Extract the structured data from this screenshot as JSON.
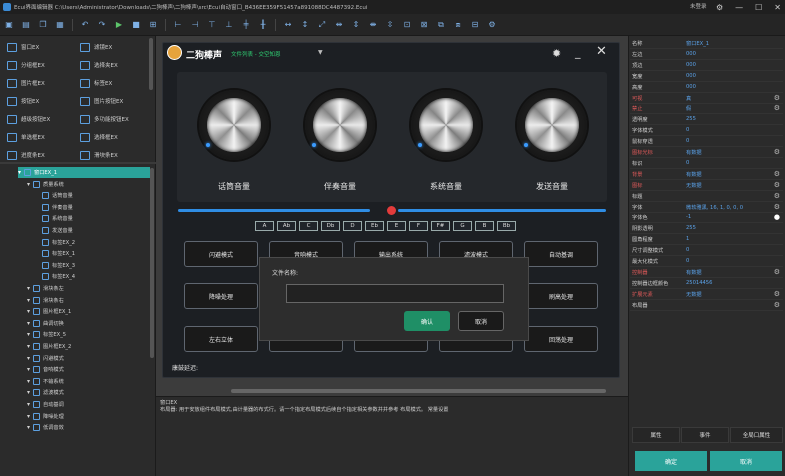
{
  "titlebar": {
    "title": "Ecui界面编辑器  C:\\Users\\Administrator\\Downloads\\二狗棒声\\二狗棒声\\src\\Ecui自动窗口_B436EE359F51457a891088DC4487392.Ecui",
    "login": "未登录"
  },
  "toolbox": {
    "items": [
      {
        "label": "窗口EX",
        "icon": "window-icon"
      },
      {
        "label": "滤镜EX",
        "icon": "filter-icon"
      },
      {
        "label": "分组框EX",
        "icon": "groupbox-icon"
      },
      {
        "label": "选择夹EX",
        "icon": "tab-icon"
      },
      {
        "label": "图片框EX",
        "icon": "picture-icon"
      },
      {
        "label": "标签EX",
        "icon": "tag-icon"
      },
      {
        "label": "按钮EX",
        "icon": "button-icon"
      },
      {
        "label": "图片按钮EX",
        "icon": "image-button-icon"
      },
      {
        "label": "超级按钮EX",
        "icon": "super-button-icon"
      },
      {
        "label": "多功能按钮EX",
        "icon": "multi-button-icon"
      },
      {
        "label": "单选框EX",
        "icon": "radio-icon"
      },
      {
        "label": "选择框EX",
        "icon": "checkbox-icon"
      },
      {
        "label": "进度条EX",
        "icon": "progress-icon"
      },
      {
        "label": "滑块条EX",
        "icon": "slider-icon"
      }
    ]
  },
  "tree": {
    "items": [
      {
        "label": "窗口EX_1",
        "indent": 0,
        "selected": true
      },
      {
        "label": "质量系统",
        "indent": 1
      },
      {
        "label": "话筒音量",
        "indent": 2
      },
      {
        "label": "伴奏音量",
        "indent": 2
      },
      {
        "label": "系统音量",
        "indent": 2
      },
      {
        "label": "发送音量",
        "indent": 2
      },
      {
        "label": "标签EX_2",
        "indent": 2
      },
      {
        "label": "标签EX_1",
        "indent": 2
      },
      {
        "label": "标签EX_3",
        "indent": 2
      },
      {
        "label": "标签EX_4",
        "indent": 2
      },
      {
        "label": "滑块条左",
        "indent": 1
      },
      {
        "label": "滑块条右",
        "indent": 1
      },
      {
        "label": "图片框EX_1",
        "indent": 1
      },
      {
        "label": "曲调切换",
        "indent": 1
      },
      {
        "label": "标签EX_5",
        "indent": 1
      },
      {
        "label": "图片框EX_2",
        "indent": 1
      },
      {
        "label": "闪避模式",
        "indent": 1
      },
      {
        "label": "音响模式",
        "indent": 1
      },
      {
        "label": "不输系统",
        "indent": 1
      },
      {
        "label": "滤波模式",
        "indent": 1
      },
      {
        "label": "自动基调",
        "indent": 1
      },
      {
        "label": "降噪处理",
        "indent": 1
      },
      {
        "label": "低调音效",
        "indent": 1
      }
    ]
  },
  "app": {
    "title": "二狗棒声",
    "subtitle": "文件列表 - 交空知恩",
    "knobs": [
      {
        "label": "话筒音量"
      },
      {
        "label": "伴奏音量"
      },
      {
        "label": "系统音量"
      },
      {
        "label": "发送音量"
      }
    ],
    "keys": [
      "A",
      "Ab",
      "C",
      "Db",
      "D",
      "Eb",
      "E",
      "F",
      "F#",
      "G",
      "B",
      "Bb"
    ],
    "buttons": [
      "闪避模式",
      "音响模式",
      "输出系统",
      "滤波模式",
      "自动基调",
      "降噪处理",
      "",
      "",
      "",
      "刷高处理",
      "左右立体",
      "",
      "",
      "",
      "回荡处理"
    ],
    "status": "康鼓延迟:"
  },
  "dialog": {
    "label": "文件名称:",
    "value": "",
    "ok": "确认",
    "cancel": "取消"
  },
  "desc": {
    "line1": "窗口EX",
    "line2": "布局器: 用于安放组件布局模式,由计量器的布式行。请一个指定布局模式后续自个指定相关参数并并参考 布局模式。 常量设置"
  },
  "props": [
    {
      "k": "名称",
      "v": "窗口EX_1"
    },
    {
      "k": "左边",
      "v": "000"
    },
    {
      "k": "顶边",
      "v": "000"
    },
    {
      "k": "宽度",
      "v": "000"
    },
    {
      "k": "高度",
      "v": "000"
    },
    {
      "k": "可视",
      "v": "真",
      "red": true,
      "edit": true
    },
    {
      "k": "禁止",
      "v": "假",
      "red": true,
      "edit": true
    },
    {
      "k": "透明度",
      "v": "255"
    },
    {
      "k": "字体模式",
      "v": "0"
    },
    {
      "k": "鼠标穿透",
      "v": "0"
    },
    {
      "k": "图标光标",
      "v": "有数据",
      "red": true,
      "edit": true
    },
    {
      "k": "标识",
      "v": "0"
    },
    {
      "k": "背景",
      "v": "有数据",
      "red": true,
      "edit": true
    },
    {
      "k": "图标",
      "v": "无数据",
      "red": true,
      "edit": true
    },
    {
      "k": "标题",
      "v": "",
      "edit": true
    },
    {
      "k": "字体",
      "v": "微软雅黑, 16, 1, 0, 0, 0",
      "edit": true
    },
    {
      "k": "字体色",
      "v": "-1",
      "circle": true
    },
    {
      "k": "阴影透明",
      "v": "255"
    },
    {
      "k": "圆角程度",
      "v": "1"
    },
    {
      "k": "尺寸调整模式",
      "v": "0"
    },
    {
      "k": "最大化模式",
      "v": "0"
    },
    {
      "k": "控制器",
      "v": "有数据",
      "red": true,
      "edit": true
    },
    {
      "k": "控制器边框颜色",
      "v": "25014456"
    },
    {
      "k": "扩展元素",
      "v": "无数据",
      "red": true,
      "edit": true
    },
    {
      "k": "布局器",
      "v": "",
      "edit": true
    }
  ],
  "tabs": {
    "attr": "属性",
    "event": "事件",
    "global": "全局口属性"
  },
  "footer": {
    "confirm": "确定",
    "cancel": "取消"
  }
}
